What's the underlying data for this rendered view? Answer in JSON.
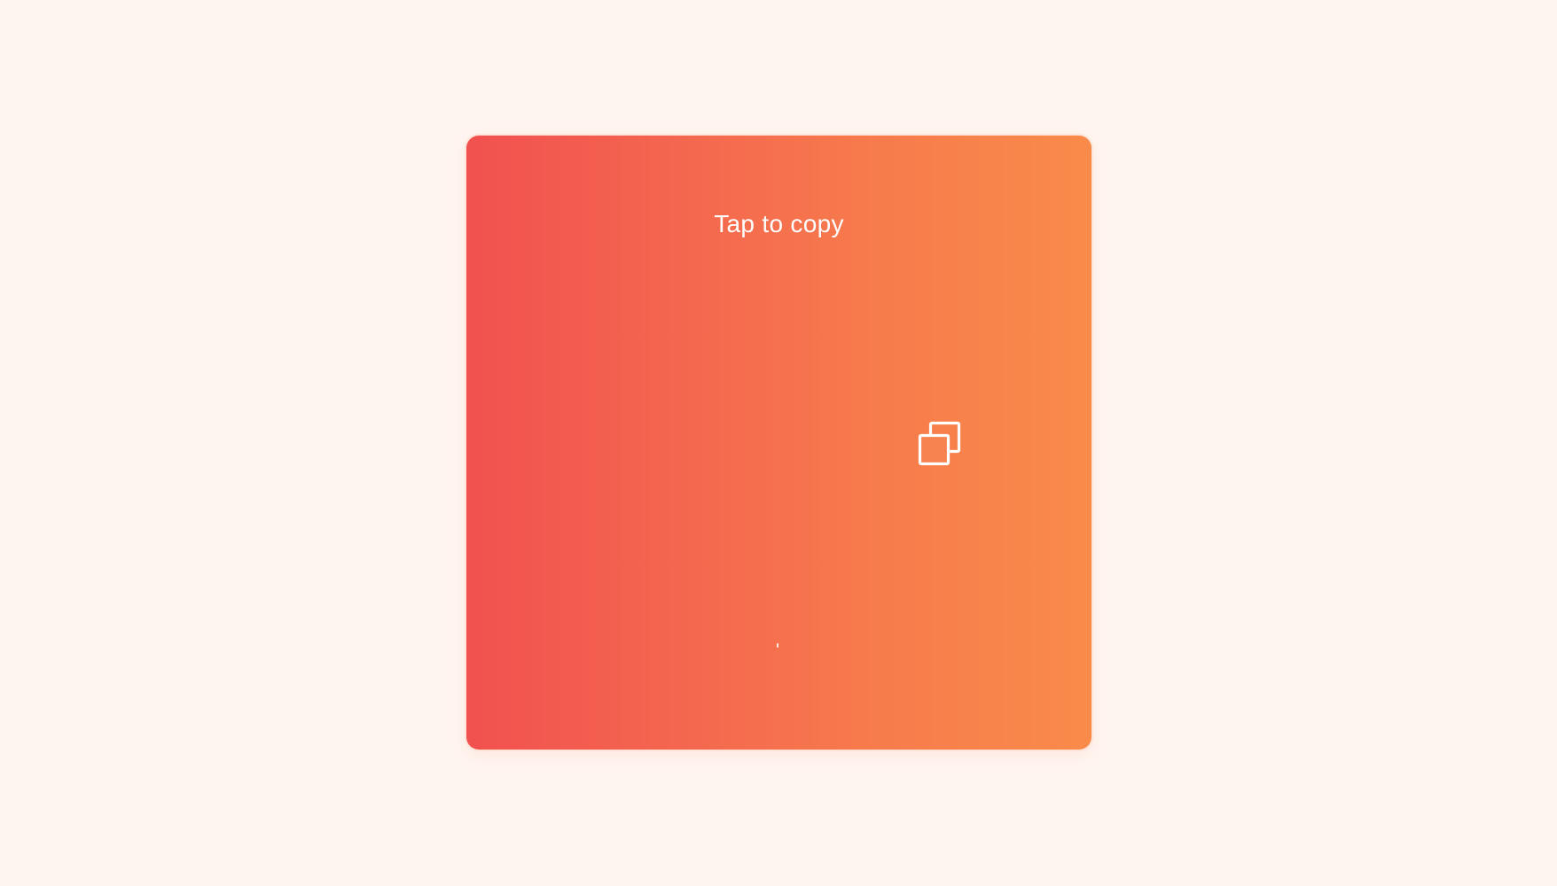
{
  "card": {
    "title": "Tap to copy",
    "gradient_start": "#f1514f",
    "gradient_end": "#f98b4a",
    "copy_icon": "copy-icon"
  },
  "page": {
    "background": "#fff5f0"
  }
}
